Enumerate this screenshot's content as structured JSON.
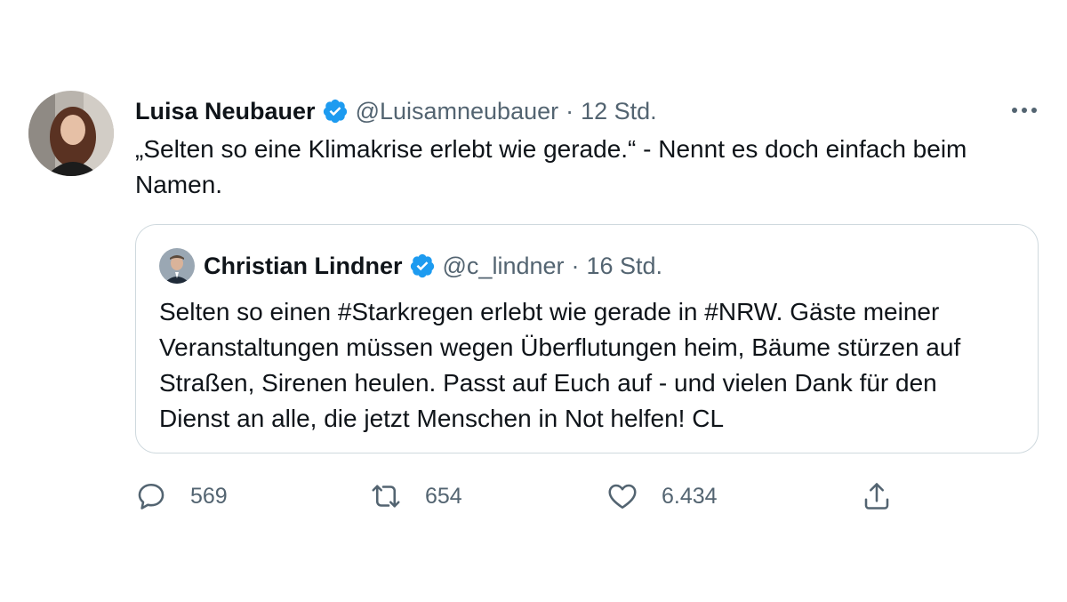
{
  "tweet": {
    "author_name": "Luisa Neubauer",
    "author_handle": "@Luisamneubauer",
    "separator": "·",
    "time": "12 Std.",
    "text": "„Selten so eine Klimakrise erlebt wie gerade.“ - Nennt es doch einfach beim Namen."
  },
  "quoted_tweet": {
    "author_name": "Christian Lindner",
    "author_handle": "@c_lindner",
    "separator": "·",
    "time": "16 Std.",
    "text": "Selten so einen #Starkregen erlebt wie gerade in #NRW. Gäste meiner Veranstaltungen müssen wegen Überflutungen heim, Bäume stürzen auf Straßen, Sirenen heulen. Passt auf Euch auf - und vielen Dank für den Dienst an alle, die jetzt Menschen in Not helfen! CL"
  },
  "actions": {
    "reply_count": "569",
    "retweet_count": "654",
    "like_count": "6.434"
  },
  "icons": {
    "verified": "verified-badge-icon",
    "more": "more-horizontal-icon",
    "reply": "reply-icon",
    "retweet": "retweet-icon",
    "like": "heart-icon",
    "share": "share-icon"
  },
  "colors": {
    "verified": "#1d9bf0",
    "text": "#0f1419",
    "secondary": "#536471",
    "border": "#cfd9de"
  }
}
